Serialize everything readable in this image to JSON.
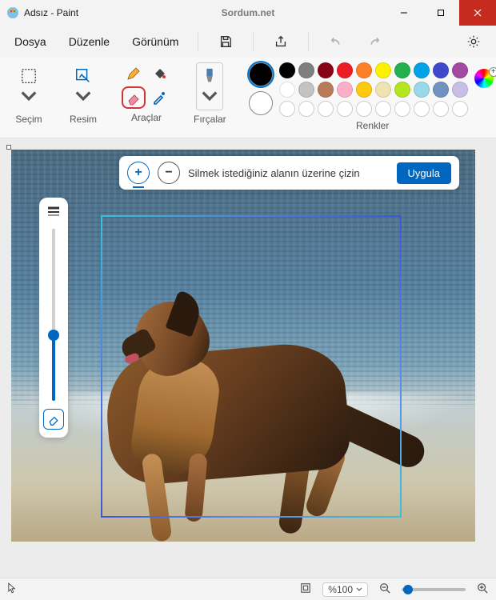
{
  "titlebar": {
    "title": "Adsız - Paint",
    "watermark": "Sordum.net"
  },
  "menu": {
    "file": "Dosya",
    "edit": "Düzenle",
    "view": "Görünüm"
  },
  "ribbon": {
    "select": "Seçim",
    "image": "Resim",
    "tools": "Araçlar",
    "brushes": "Fırçalar",
    "colors": "Renkler"
  },
  "floatbar": {
    "hint": "Silmek istediğiniz alanın üzerine çizin",
    "apply": "Uygula"
  },
  "statusbar": {
    "zoom": "%100"
  },
  "palette_row1": [
    "#000000",
    "#7f7f7f",
    "#880015",
    "#ed1c24",
    "#ff7f27",
    "#fff200",
    "#22b14c",
    "#00a2e8",
    "#3f48cc",
    "#a349a4"
  ],
  "palette_row2": [
    "#ffffff",
    "#c3c3c3",
    "#b97a57",
    "#ffaec9",
    "#ffc90e",
    "#efe4b0",
    "#b5e61d",
    "#99d9ea",
    "#7092be",
    "#c8bfe7"
  ]
}
